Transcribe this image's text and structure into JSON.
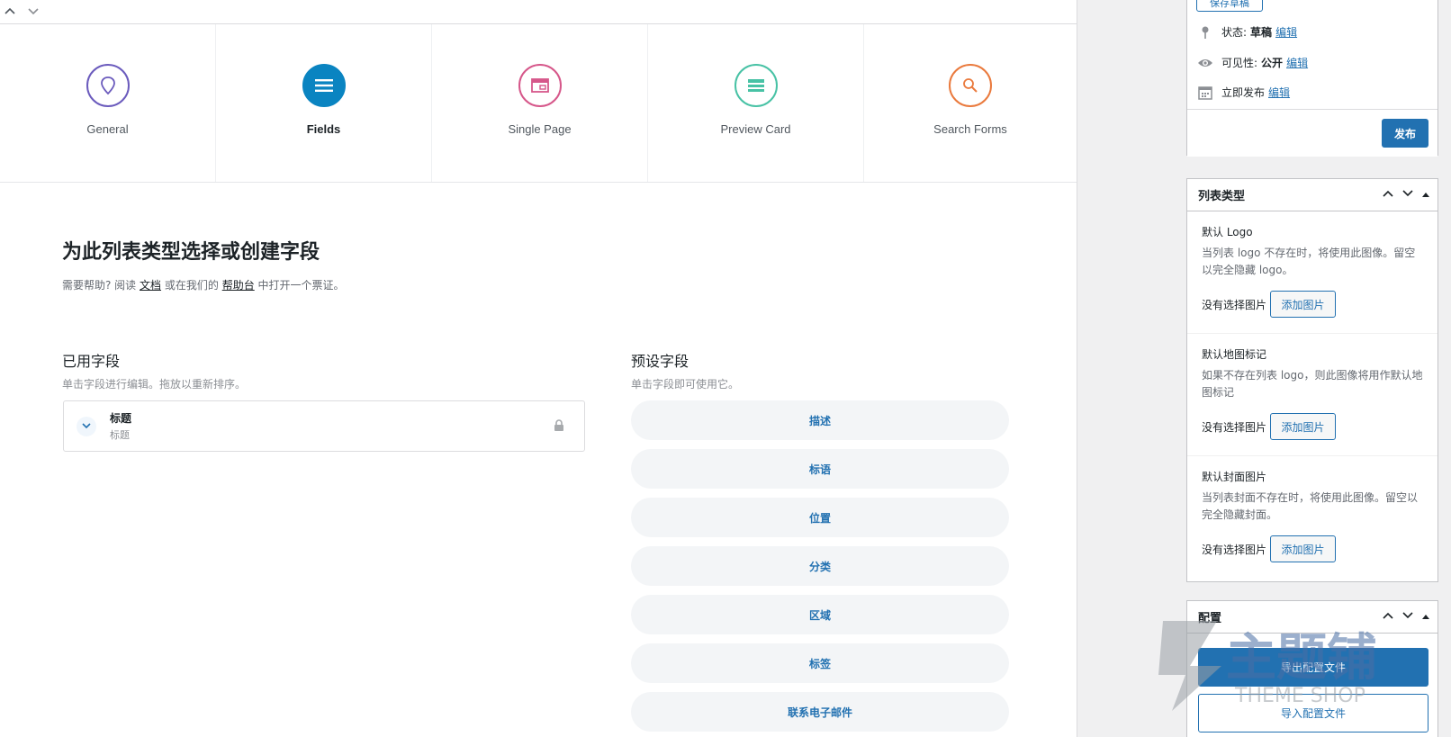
{
  "main": {
    "tabs": [
      {
        "label": "General",
        "icon": "map-pin-icon",
        "color": "#6b5bbd"
      },
      {
        "label": "Fields",
        "icon": "menu-lines-icon",
        "color": "#0a84c1"
      },
      {
        "label": "Single Page",
        "icon": "browser-window-icon",
        "color": "#d6578a"
      },
      {
        "label": "Preview Card",
        "icon": "card-stack-icon",
        "color": "#48c2a5"
      },
      {
        "label": "Search Forms",
        "icon": "search-icon",
        "color": "#ea7a3d"
      }
    ],
    "heading": "为此列表类型选择或创建字段",
    "help": {
      "prefix": "需要帮助? 阅读",
      "doc_link": "文档",
      "middle": "或在我们的",
      "helpdesk_link": "帮助台",
      "suffix": "中打开一个票证。"
    },
    "used_fields": {
      "title": "已用字段",
      "subtitle": "单击字段进行编辑。拖放以重新排序。",
      "items": [
        {
          "name": "标题",
          "key": "标题"
        }
      ]
    },
    "preset_fields": {
      "title": "预设字段",
      "subtitle": "单击字段即可使用它。",
      "items": [
        "描述",
        "标语",
        "位置",
        "分类",
        "区域",
        "标签",
        "联系电子邮件"
      ]
    }
  },
  "sidebar": {
    "publish": {
      "save_draft": "保存草稿",
      "status_label": "状态:",
      "status_value": "草稿",
      "visibility_label": "可见性:",
      "visibility_value": "公开",
      "schedule_label": "立即发布",
      "edit_link": "编辑",
      "publish_button": "发布"
    },
    "listing_type": {
      "title": "列表类型",
      "sections": [
        {
          "title": "默认 Logo",
          "desc": "当列表 logo 不存在时，将使用此图像。留空以完全隐藏 logo。",
          "no_image": "没有选择图片",
          "button": "添加图片"
        },
        {
          "title": "默认地图标记",
          "desc": "如果不存在列表 logo，则此图像将用作默认地图标记",
          "no_image": "没有选择图片",
          "button": "添加图片"
        },
        {
          "title": "默认封面图片",
          "desc": "当列表封面不存在时，将使用此图像。留空以完全隐藏封面。",
          "no_image": "没有选择图片",
          "button": "添加图片"
        }
      ]
    },
    "config": {
      "title": "配置",
      "export": "导出配置文件",
      "import": "导入配置文件"
    }
  },
  "watermark": {
    "text": "主题铺",
    "subtext": "THEME SHOP"
  }
}
